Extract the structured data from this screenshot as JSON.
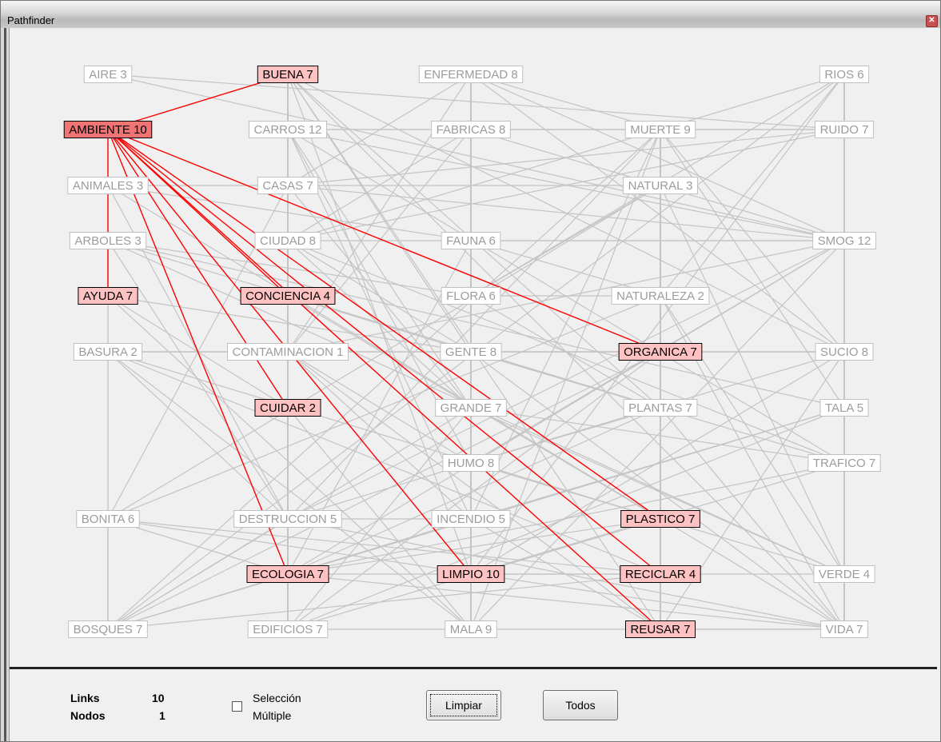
{
  "window": {
    "title": "Pathfinder",
    "close_glyph": "✕"
  },
  "nodes": [
    {
      "id": "aire",
      "label": "AIRE 3",
      "state": "normal"
    },
    {
      "id": "buena",
      "label": "BUENA 7",
      "state": "linked"
    },
    {
      "id": "enfermedad",
      "label": "ENFERMEDAD 8",
      "state": "normal"
    },
    {
      "id": "rios",
      "label": "RIOS 6",
      "state": "normal"
    },
    {
      "id": "ambiente",
      "label": "AMBIENTE 10",
      "state": "selected"
    },
    {
      "id": "carros",
      "label": "CARROS 12",
      "state": "normal"
    },
    {
      "id": "fabricas",
      "label": "FABRICAS 8",
      "state": "normal"
    },
    {
      "id": "muerte",
      "label": "MUERTE 9",
      "state": "normal"
    },
    {
      "id": "ruido",
      "label": "RUIDO 7",
      "state": "normal"
    },
    {
      "id": "animales",
      "label": "ANIMALES 3",
      "state": "normal"
    },
    {
      "id": "casas",
      "label": "CASAS 7",
      "state": "normal"
    },
    {
      "id": "natural",
      "label": "NATURAL 3",
      "state": "normal"
    },
    {
      "id": "arboles",
      "label": "ARBOLES 3",
      "state": "normal"
    },
    {
      "id": "ciudad",
      "label": "CIUDAD 8",
      "state": "normal"
    },
    {
      "id": "fauna",
      "label": "FAUNA 6",
      "state": "normal"
    },
    {
      "id": "smog",
      "label": "SMOG 12",
      "state": "normal"
    },
    {
      "id": "ayuda",
      "label": "AYUDA 7",
      "state": "linked"
    },
    {
      "id": "conciencia",
      "label": "CONCIENCIA 4",
      "state": "linked"
    },
    {
      "id": "flora",
      "label": "FLORA 6",
      "state": "normal"
    },
    {
      "id": "naturaleza",
      "label": "NATURALEZA 2",
      "state": "normal"
    },
    {
      "id": "basura",
      "label": "BASURA 2",
      "state": "normal"
    },
    {
      "id": "contaminacion",
      "label": "CONTAMINACION 1",
      "state": "normal"
    },
    {
      "id": "gente",
      "label": "GENTE 8",
      "state": "normal"
    },
    {
      "id": "organica",
      "label": "ORGANICA 7",
      "state": "linked"
    },
    {
      "id": "sucio",
      "label": "SUCIO 8",
      "state": "normal"
    },
    {
      "id": "cuidar",
      "label": "CUIDAR 2",
      "state": "linked"
    },
    {
      "id": "grande",
      "label": "GRANDE 7",
      "state": "normal"
    },
    {
      "id": "plantas",
      "label": "PLANTAS 7",
      "state": "normal"
    },
    {
      "id": "tala",
      "label": "TALA 5",
      "state": "normal"
    },
    {
      "id": "humo",
      "label": "HUMO 8",
      "state": "normal"
    },
    {
      "id": "trafico",
      "label": "TRAFICO 7",
      "state": "normal"
    },
    {
      "id": "bonita",
      "label": "BONITA 6",
      "state": "normal"
    },
    {
      "id": "destruccion",
      "label": "DESTRUCCION 5",
      "state": "normal"
    },
    {
      "id": "incendio",
      "label": "INCENDIO 5",
      "state": "normal"
    },
    {
      "id": "plastico",
      "label": "PLASTICO 7",
      "state": "linked"
    },
    {
      "id": "ecologia",
      "label": "ECOLOGIA 7",
      "state": "linked"
    },
    {
      "id": "limpio",
      "label": "LIMPIO 10",
      "state": "linked"
    },
    {
      "id": "reciclar",
      "label": "RECICLAR 4",
      "state": "linked"
    },
    {
      "id": "verde",
      "label": "VERDE 4",
      "state": "normal"
    },
    {
      "id": "bosques",
      "label": "BOSQUES 7",
      "state": "normal"
    },
    {
      "id": "edificios",
      "label": "EDIFICIOS 7",
      "state": "normal"
    },
    {
      "id": "mala",
      "label": "MALA 9",
      "state": "normal"
    },
    {
      "id": "reusar",
      "label": "REUSAR 7",
      "state": "linked"
    },
    {
      "id": "vida",
      "label": "VIDA 7",
      "state": "normal"
    }
  ],
  "highlighted_links": [
    [
      "ambiente",
      "buena"
    ],
    [
      "ambiente",
      "ayuda"
    ],
    [
      "ambiente",
      "conciencia"
    ],
    [
      "ambiente",
      "cuidar"
    ],
    [
      "ambiente",
      "ecologia"
    ],
    [
      "ambiente",
      "limpio"
    ],
    [
      "ambiente",
      "plastico"
    ],
    [
      "ambiente",
      "reciclar"
    ],
    [
      "ambiente",
      "organica"
    ],
    [
      "ambiente",
      "reusar"
    ]
  ],
  "background_links": [
    [
      "aire",
      "smog"
    ],
    [
      "aire",
      "ruido"
    ],
    [
      "buena",
      "reusar"
    ],
    [
      "buena",
      "plantas"
    ],
    [
      "buena",
      "gente"
    ],
    [
      "buena",
      "limpio"
    ],
    [
      "buena",
      "sucio"
    ],
    [
      "buena",
      "vida"
    ],
    [
      "enfermedad",
      "mala"
    ],
    [
      "enfermedad",
      "humo"
    ],
    [
      "enfermedad",
      "smog"
    ],
    [
      "enfermedad",
      "casas"
    ],
    [
      "enfermedad",
      "sucio"
    ],
    [
      "enfermedad",
      "contaminacion"
    ],
    [
      "rios",
      "verde"
    ],
    [
      "rios",
      "flora"
    ],
    [
      "rios",
      "ciudad"
    ],
    [
      "rios",
      "bosques"
    ],
    [
      "rios",
      "naturaleza"
    ],
    [
      "rios",
      "limpio"
    ],
    [
      "carros",
      "trafico"
    ],
    [
      "carros",
      "smog"
    ],
    [
      "carros",
      "ruido"
    ],
    [
      "carros",
      "humo"
    ],
    [
      "carros",
      "muerte"
    ],
    [
      "carros",
      "edificios"
    ],
    [
      "carros",
      "grande"
    ],
    [
      "carros",
      "incendio"
    ],
    [
      "fabricas",
      "smog"
    ],
    [
      "fabricas",
      "humo"
    ],
    [
      "fabricas",
      "ruido"
    ],
    [
      "fabricas",
      "contaminacion"
    ],
    [
      "fabricas",
      "mala"
    ],
    [
      "fabricas",
      "ciudad"
    ],
    [
      "muerte",
      "mala"
    ],
    [
      "muerte",
      "destruccion"
    ],
    [
      "muerte",
      "tala"
    ],
    [
      "muerte",
      "enfermedad"
    ],
    [
      "muerte",
      "incendio"
    ],
    [
      "muerte",
      "sucio"
    ],
    [
      "muerte",
      "bosques"
    ],
    [
      "ruido",
      "ciudad"
    ],
    [
      "ruido",
      "trafico"
    ],
    [
      "ruido",
      "casas"
    ],
    [
      "animales",
      "fauna"
    ],
    [
      "animales",
      "vida"
    ],
    [
      "animales",
      "destruccion"
    ],
    [
      "animales",
      "natural"
    ],
    [
      "animales",
      "bosques"
    ],
    [
      "casas",
      "edificios"
    ],
    [
      "casas",
      "ciudad"
    ],
    [
      "casas",
      "bonita"
    ],
    [
      "casas",
      "grande"
    ],
    [
      "casas",
      "smog"
    ],
    [
      "natural",
      "naturaleza"
    ],
    [
      "natural",
      "bonita"
    ],
    [
      "natural",
      "flora"
    ],
    [
      "natural",
      "verde"
    ],
    [
      "arboles",
      "plantas"
    ],
    [
      "arboles",
      "verde"
    ],
    [
      "arboles",
      "tala"
    ],
    [
      "arboles",
      "bosques"
    ],
    [
      "arboles",
      "flora"
    ],
    [
      "arboles",
      "destruccion"
    ],
    [
      "ciudad",
      "edificios"
    ],
    [
      "ciudad",
      "smog"
    ],
    [
      "ciudad",
      "gente"
    ],
    [
      "ciudad",
      "trafico"
    ],
    [
      "ciudad",
      "grande"
    ],
    [
      "fauna",
      "flora"
    ],
    [
      "fauna",
      "smog"
    ],
    [
      "fauna",
      "naturaleza"
    ],
    [
      "fauna",
      "ecologia"
    ],
    [
      "smog",
      "humo"
    ],
    [
      "smog",
      "contaminacion"
    ],
    [
      "smog",
      "mala"
    ],
    [
      "smog",
      "verde"
    ],
    [
      "smog",
      "destruccion"
    ],
    [
      "smog",
      "ecologia"
    ],
    [
      "ayuda",
      "gente"
    ],
    [
      "ayuda",
      "cuidar"
    ],
    [
      "ayuda",
      "mala"
    ],
    [
      "conciencia",
      "gente"
    ],
    [
      "conciencia",
      "cuidar"
    ],
    [
      "conciencia",
      "plastico"
    ],
    [
      "flora",
      "plantas"
    ],
    [
      "flora",
      "naturaleza"
    ],
    [
      "flora",
      "mala"
    ],
    [
      "naturaleza",
      "bonita"
    ],
    [
      "naturaleza",
      "verde"
    ],
    [
      "naturaleza",
      "vida"
    ],
    [
      "basura",
      "sucio"
    ],
    [
      "basura",
      "reciclar"
    ],
    [
      "basura",
      "plastico"
    ],
    [
      "basura",
      "mala"
    ],
    [
      "basura",
      "contaminacion"
    ],
    [
      "basura",
      "organica"
    ],
    [
      "basura",
      "destruccion"
    ],
    [
      "contaminacion",
      "humo"
    ],
    [
      "contaminacion",
      "sucio"
    ],
    [
      "contaminacion",
      "reusar"
    ],
    [
      "contaminacion",
      "edificios"
    ],
    [
      "contaminacion",
      "incendio"
    ],
    [
      "gente",
      "vida"
    ],
    [
      "gente",
      "plantas"
    ],
    [
      "gente",
      "sucio"
    ],
    [
      "gente",
      "mala"
    ],
    [
      "gente",
      "trafico"
    ],
    [
      "organica",
      "reciclar"
    ],
    [
      "organica",
      "edificios"
    ],
    [
      "organica",
      "bosques"
    ],
    [
      "sucio",
      "humo"
    ],
    [
      "sucio",
      "reusar"
    ],
    [
      "sucio",
      "limpio"
    ],
    [
      "cuidar",
      "ecologia"
    ],
    [
      "cuidar",
      "edificios"
    ],
    [
      "cuidar",
      "mala"
    ],
    [
      "grande",
      "bosques"
    ],
    [
      "grande",
      "mala"
    ],
    [
      "grande",
      "edificios"
    ],
    [
      "grande",
      "verde"
    ],
    [
      "plantas",
      "reusar"
    ],
    [
      "plantas",
      "vida"
    ],
    [
      "plantas",
      "ecologia"
    ],
    [
      "plantas",
      "humo"
    ],
    [
      "tala",
      "bosques"
    ],
    [
      "tala",
      "incendio"
    ],
    [
      "tala",
      "edificios"
    ],
    [
      "humo",
      "incendio"
    ],
    [
      "humo",
      "destruccion"
    ],
    [
      "humo",
      "mala"
    ],
    [
      "humo",
      "plastico"
    ],
    [
      "trafico",
      "limpio"
    ],
    [
      "trafico",
      "ecologia"
    ],
    [
      "trafico",
      "grande"
    ],
    [
      "bonita",
      "vida"
    ],
    [
      "bonita",
      "ecologia"
    ],
    [
      "bonita",
      "bosques"
    ],
    [
      "bonita",
      "reciclar"
    ],
    [
      "destruccion",
      "incendio"
    ],
    [
      "destruccion",
      "bosques"
    ],
    [
      "destruccion",
      "vida"
    ],
    [
      "incendio",
      "bosques"
    ],
    [
      "incendio",
      "mala"
    ],
    [
      "incendio",
      "reusar"
    ],
    [
      "plastico",
      "ecologia"
    ],
    [
      "plastico",
      "verde"
    ],
    [
      "plastico",
      "edificios"
    ],
    [
      "ecologia",
      "limpio"
    ],
    [
      "ecologia",
      "vida"
    ],
    [
      "limpio",
      "verde"
    ],
    [
      "limpio",
      "mala"
    ],
    [
      "limpio",
      "reciclar"
    ],
    [
      "reciclar",
      "reusar"
    ],
    [
      "reciclar",
      "bosques"
    ],
    [
      "verde",
      "vida"
    ],
    [
      "reusar",
      "vida"
    ],
    [
      "edificios",
      "mala"
    ],
    [
      "mala",
      "vida"
    ]
  ],
  "stats": {
    "links_label": "Links",
    "links_value": "10",
    "nodes_label": "Nodos",
    "nodes_value": "1"
  },
  "multi_select": {
    "checked": false,
    "line1": "Selección",
    "line2": "Múltiple"
  },
  "buttons": {
    "clear_label": "Limpiar",
    "all_label": "Todos"
  },
  "colors": {
    "selected_fill": "#f07474",
    "linked_fill": "#ffc2c2",
    "normal_fill": "#ffffff",
    "normal_text": "#9c9c9c",
    "normal_border": "#c0c0c0",
    "highlight_link": "#ff0000",
    "background_link": "#c4c4c4"
  }
}
